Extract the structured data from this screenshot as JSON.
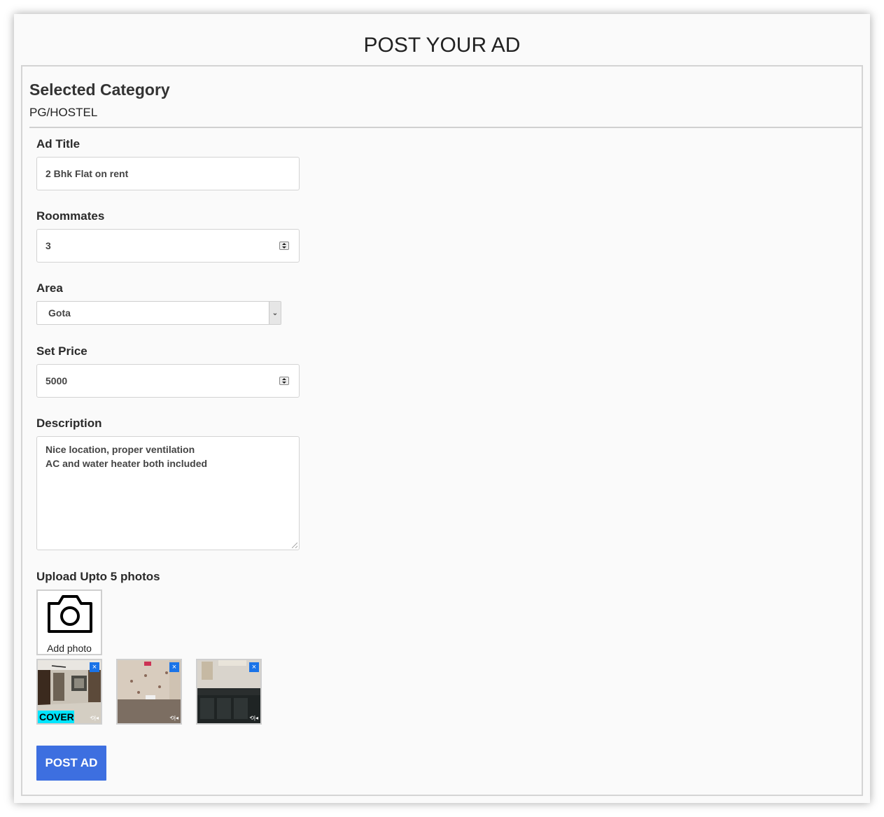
{
  "page": {
    "title": "POST YOUR AD"
  },
  "category": {
    "heading": "Selected Category",
    "value": "PG/HOSTEL"
  },
  "form": {
    "ad_title": {
      "label": "Ad Title",
      "value": "2 Bhk Flat on rent"
    },
    "roommates": {
      "label": "Roommates",
      "value": "3"
    },
    "area": {
      "label": "Area",
      "selected": "Gota"
    },
    "price": {
      "label": "Set Price",
      "value": "5000"
    },
    "description": {
      "label": "Description",
      "line1": "Nice location, proper ventilation",
      "line2": "AC and water heater both included"
    }
  },
  "photos": {
    "label": "Upload Upto 5 photos",
    "add_label": "Add photo",
    "cover_label": "COVER",
    "close_glyph": "×",
    "rotate_glyph": "⟲|◂",
    "items": [
      {
        "icon": "room-photo",
        "is_cover": true
      },
      {
        "icon": "bathroom-photo",
        "is_cover": false
      },
      {
        "icon": "kitchen-photo",
        "is_cover": false
      }
    ]
  },
  "actions": {
    "submit_label": "POST AD"
  },
  "colors": {
    "button": "#3d6fe0",
    "cover_badge": "#00e5ff",
    "close_badge": "#1a73e8"
  }
}
